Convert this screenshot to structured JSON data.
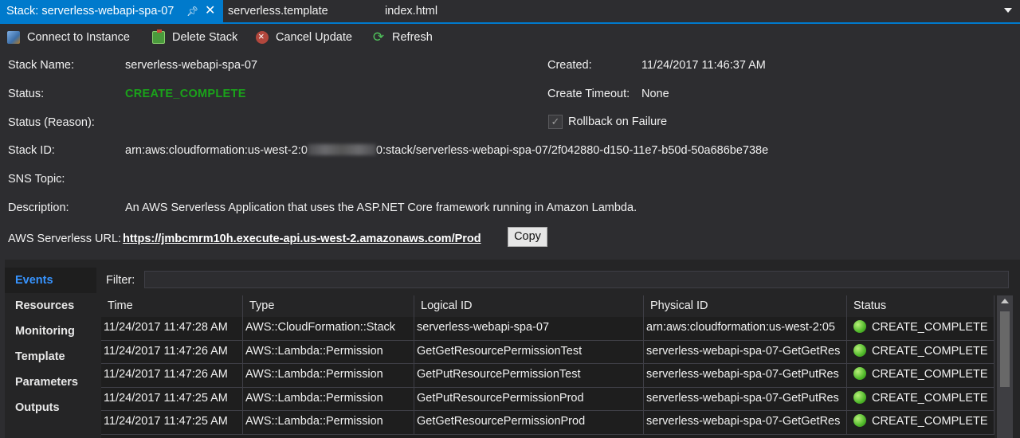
{
  "tabs": [
    {
      "label": "Stack: serverless-webapi-spa-07",
      "active": true
    },
    {
      "label": "serverless.template"
    },
    {
      "label": "index.html"
    }
  ],
  "toolbar": {
    "connect": "Connect to Instance",
    "delete": "Delete Stack",
    "cancel": "Cancel Update",
    "refresh": "Refresh"
  },
  "details": {
    "stack_name_label": "Stack Name:",
    "stack_name": "serverless-webapi-spa-07",
    "status_label": "Status:",
    "status": "CREATE_COMPLETE",
    "status_reason_label": "Status (Reason):",
    "stack_id_label": "Stack ID:",
    "stack_id_prefix": "arn:aws:cloudformation:us-west-2:0",
    "stack_id_suffix": "0:stack/serverless-webapi-spa-07/2f042880-d150-11e7-b50d-50a686be738e",
    "sns_label": "SNS Topic:",
    "description_label": "Description:",
    "description": "An AWS Serverless Application that uses the ASP.NET Core framework running in Amazon Lambda.",
    "url_label": "AWS Serverless URL:",
    "url": "https://jmbcmrm10h.execute-api.us-west-2.amazonaws.com/Prod",
    "copy": "Copy",
    "created_label": "Created:",
    "created": "11/24/2017 11:46:37 AM",
    "timeout_label": "Create Timeout:",
    "timeout": "None",
    "rollback_label": "Rollback on Failure",
    "rollback_checked": true
  },
  "sidebar": {
    "items": [
      {
        "label": "Events",
        "active": true
      },
      {
        "label": "Resources"
      },
      {
        "label": "Monitoring"
      },
      {
        "label": "Template"
      },
      {
        "label": "Parameters"
      },
      {
        "label": "Outputs"
      }
    ]
  },
  "events": {
    "filter_label": "Filter:",
    "columns": [
      "Time",
      "Type",
      "Logical ID",
      "Physical ID",
      "Status"
    ],
    "rows": [
      {
        "time": "11/24/2017 11:47:28 AM",
        "type": "AWS::CloudFormation::Stack",
        "logical": "serverless-webapi-spa-07",
        "physical": "arn:aws:cloudformation:us-west-2:05",
        "status": "CREATE_COMPLETE"
      },
      {
        "time": "11/24/2017 11:47:26 AM",
        "type": "AWS::Lambda::Permission",
        "logical": "GetGetResourcePermissionTest",
        "physical": "serverless-webapi-spa-07-GetGetRes",
        "status": "CREATE_COMPLETE"
      },
      {
        "time": "11/24/2017 11:47:26 AM",
        "type": "AWS::Lambda::Permission",
        "logical": "GetPutResourcePermissionTest",
        "physical": "serverless-webapi-spa-07-GetPutRes",
        "status": "CREATE_COMPLETE"
      },
      {
        "time": "11/24/2017 11:47:25 AM",
        "type": "AWS::Lambda::Permission",
        "logical": "GetPutResourcePermissionProd",
        "physical": "serverless-webapi-spa-07-GetPutRes",
        "status": "CREATE_COMPLETE"
      },
      {
        "time": "11/24/2017 11:47:25 AM",
        "type": "AWS::Lambda::Permission",
        "logical": "GetGetResourcePermissionProd",
        "physical": "serverless-webapi-spa-07-GetGetRes",
        "status": "CREATE_COMPLETE"
      }
    ]
  },
  "colors": {
    "accent": "#007acc",
    "status_green": "#1aa31a",
    "background": "#2d2d30"
  }
}
